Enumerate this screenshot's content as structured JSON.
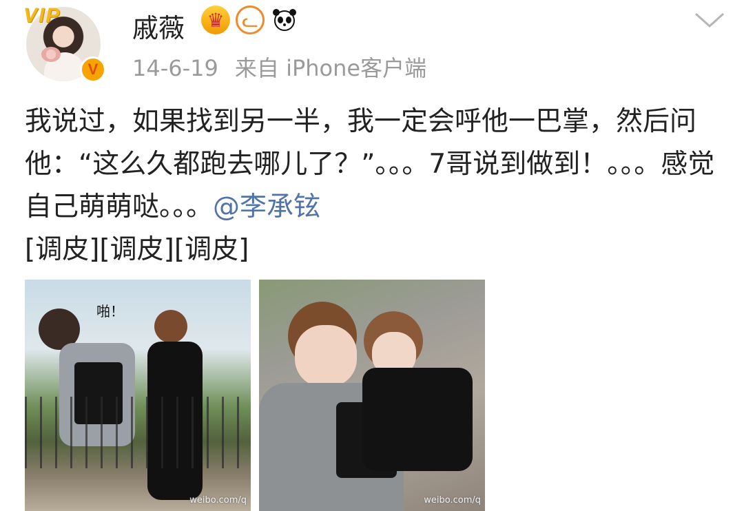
{
  "profile": {
    "vip_label": "VIP",
    "verified_mark": "V",
    "username": "戚薇",
    "badges": [
      "crown-badge-icon",
      "cat-badge-icon",
      "panda-badge-icon"
    ]
  },
  "meta": {
    "date": "14-6-19",
    "source": "来自 iPhone客户端"
  },
  "post": {
    "text_before_mention": "我说过，如果找到另一半，我一定会呼他一巴掌，然后问他：“这么久都跑去哪儿了？”。。。7哥说到做到！。。。感觉自己萌萌哒。。。",
    "mention": "@李承铉",
    "text_after_mention": "[调皮][调皮][调皮]"
  },
  "photos": [
    {
      "caption": "啪！",
      "watermark": "weibo.com/q"
    },
    {
      "watermark": "weibo.com/q"
    }
  ],
  "colors": {
    "mention": "#5073a8",
    "meta": "#9a9a9a",
    "vip": "#f3b81a"
  }
}
